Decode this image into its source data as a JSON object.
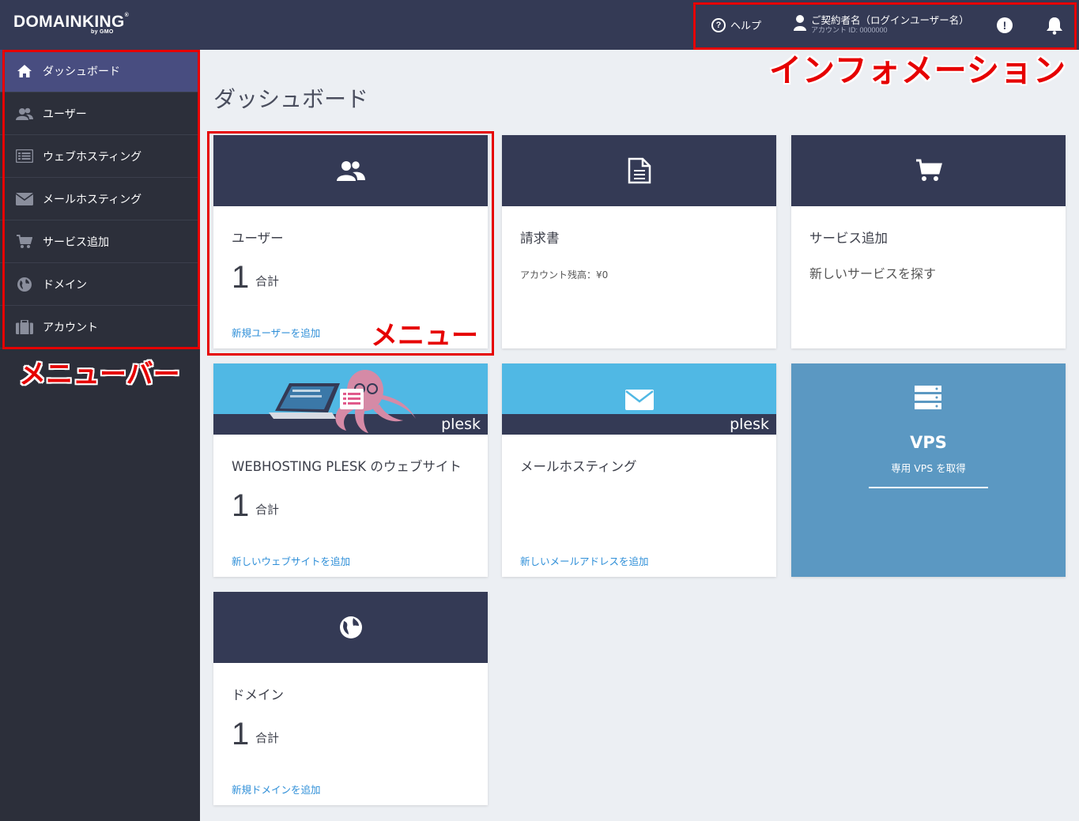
{
  "header": {
    "logo_main": "DOMAINKING",
    "logo_reg": "®",
    "logo_sub": "by GMO",
    "help_label": "ヘルプ",
    "user_name": "ご契約者名（ログインユーザー名）",
    "account_id": "アカウント ID: 0000000",
    "icons": [
      "help-icon",
      "user-icon",
      "alert-icon",
      "bell-icon"
    ]
  },
  "annotations": {
    "info": "インフォメーション",
    "menubar": "メニューバー",
    "menu": "メニュー"
  },
  "sidebar": {
    "items": [
      {
        "label": "ダッシュボード",
        "icon": "home-icon",
        "active": true
      },
      {
        "label": "ユーザー",
        "icon": "users-icon"
      },
      {
        "label": "ウェブホスティング",
        "icon": "list-icon"
      },
      {
        "label": "メールホスティング",
        "icon": "envelope-icon"
      },
      {
        "label": "サービス追加",
        "icon": "cart-icon"
      },
      {
        "label": "ドメイン",
        "icon": "globe-icon"
      },
      {
        "label": "アカウント",
        "icon": "briefcase-icon"
      }
    ]
  },
  "main": {
    "title": "ダッシュボード",
    "cards": {
      "users": {
        "title": "ユーザー",
        "count": "1",
        "unit": "合計",
        "link": "新規ユーザーを追加"
      },
      "invoice": {
        "title": "請求書",
        "sub": "アカウント残高：¥0"
      },
      "service": {
        "title": "サービス追加",
        "sub": "新しいサービスを探す"
      },
      "web": {
        "title": "WEBHOSTING PLESK のウェブサイト",
        "count": "1",
        "unit": "合計",
        "link": "新しいウェブサイトを追加",
        "brand": "plesk"
      },
      "mail": {
        "title": "メールホスティング",
        "link": "新しいメールアドレスを追加",
        "brand": "plesk"
      },
      "vps": {
        "title": "VPS",
        "sub": "専用 VPS を取得"
      },
      "domain": {
        "title": "ドメイン",
        "count": "1",
        "unit": "合計",
        "link": "新規ドメインを追加"
      }
    }
  },
  "colors": {
    "header_bg": "#343a55",
    "sidebar_bg": "#2c2f3a",
    "active_item": "#484d80",
    "link": "#2f8fd8",
    "annotation_red": "#e60000",
    "vps_bg": "#5b98c2",
    "plesk_bg": "#50b8e4"
  }
}
